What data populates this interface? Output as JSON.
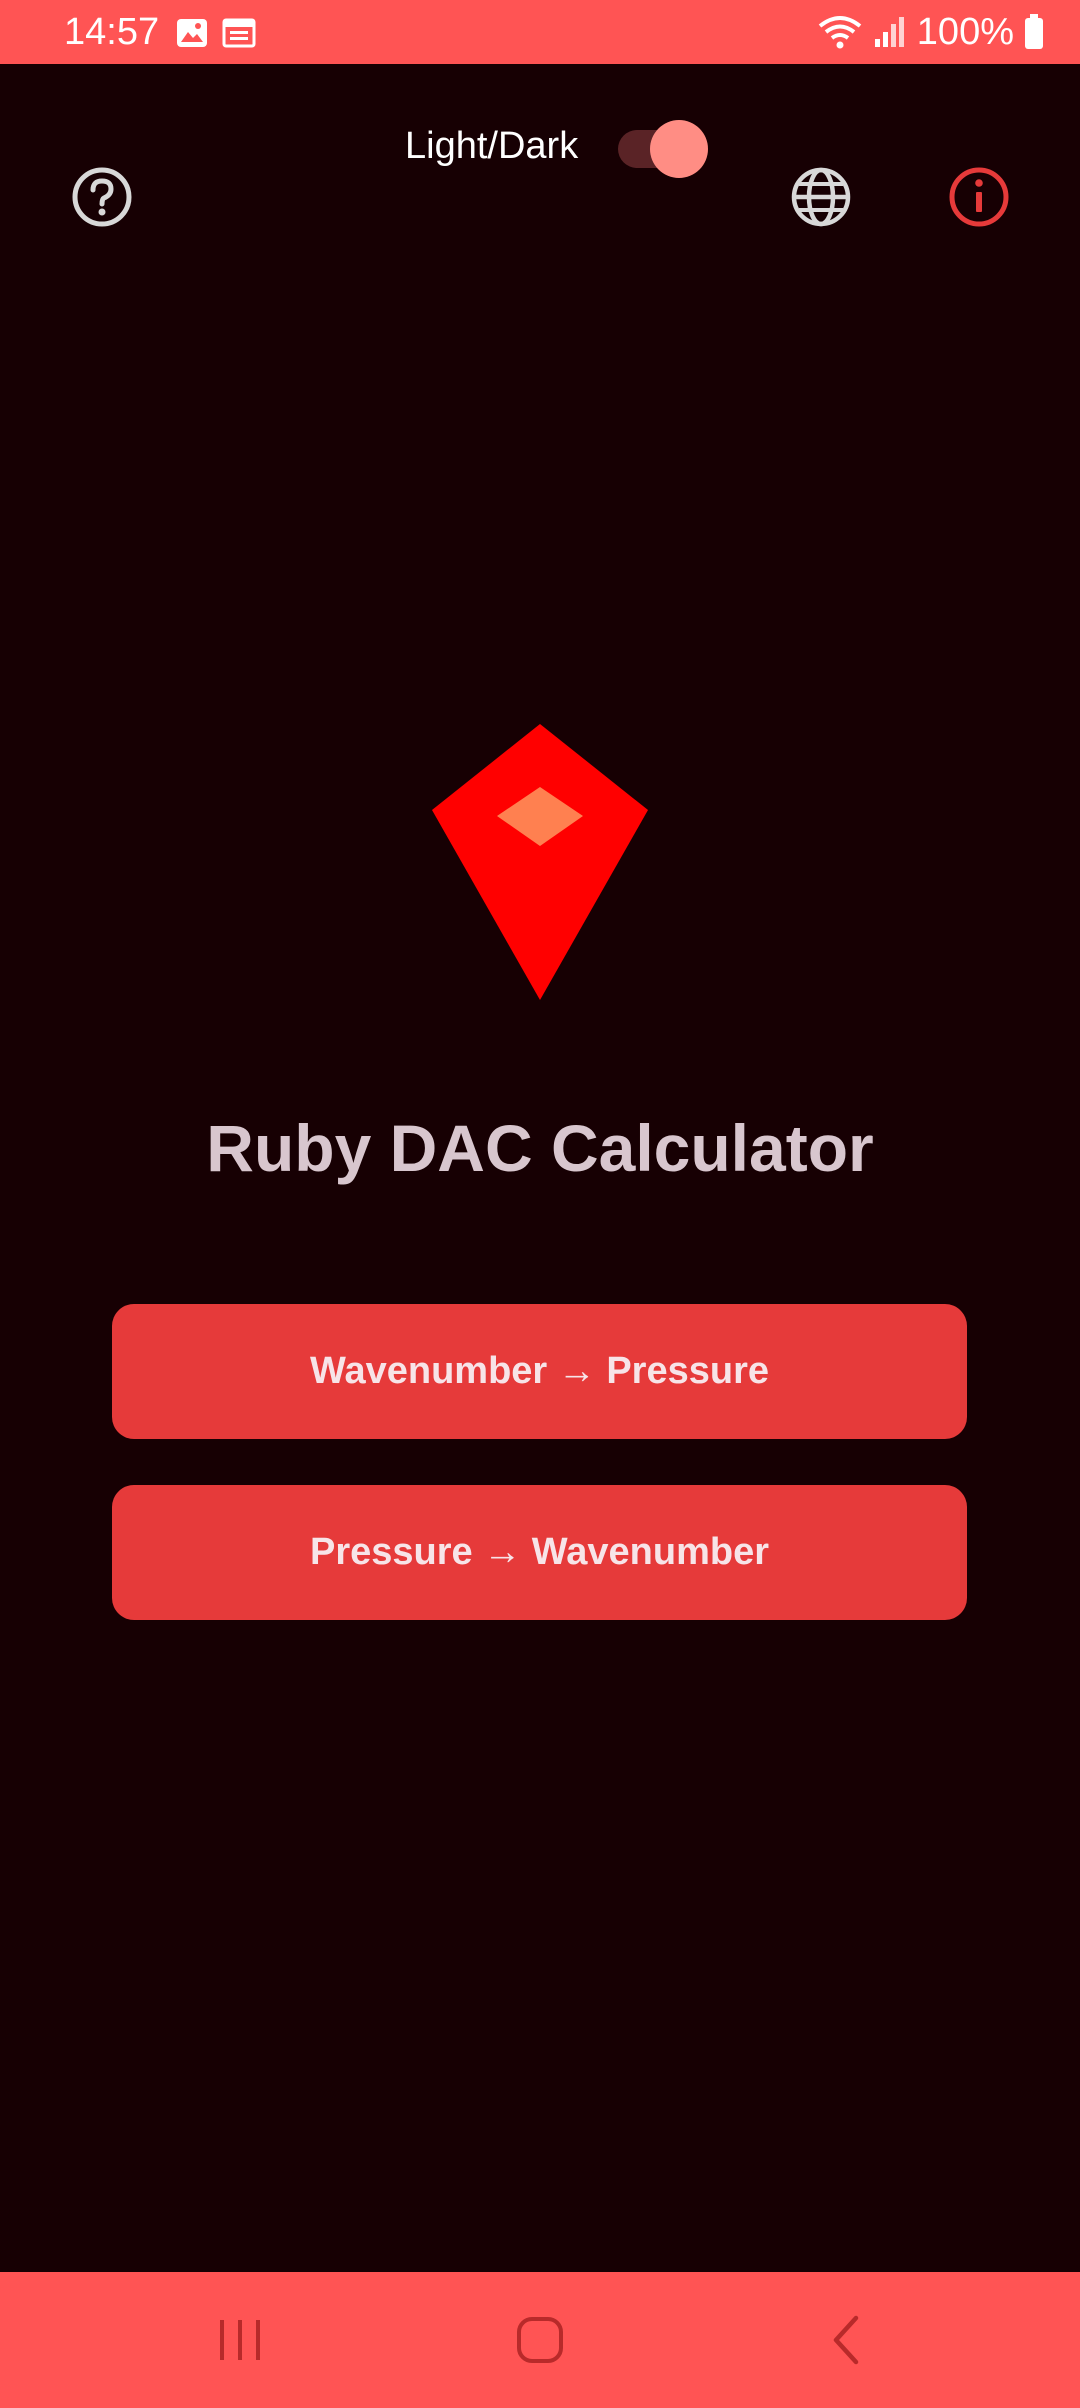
{
  "status_bar": {
    "time": "14:57",
    "battery": "100%",
    "icons": [
      "image-icon",
      "calendar-icon",
      "wifi-icon",
      "signal-icon",
      "battery-icon"
    ],
    "color": "#ff5454"
  },
  "header": {
    "toggle_label": "Light/Dark",
    "toggle_on": true,
    "icons": [
      "help-icon",
      "language-icon",
      "info-icon"
    ]
  },
  "main": {
    "title": "Ruby DAC Calculator",
    "buttons": [
      {
        "label": "Wavenumber → Pressure"
      },
      {
        "label": "Pressure → Wavenumber"
      }
    ]
  },
  "nav_bar": {
    "icons": [
      "recents-icon",
      "home-icon",
      "back-icon"
    ]
  },
  "colors": {
    "background": "#170003",
    "accent": "#e63a3a",
    "status_bar": "#ff5454",
    "ruby": "#ff0000",
    "ruby_highlight": "#ff8050",
    "title": "#d8c6ce"
  }
}
